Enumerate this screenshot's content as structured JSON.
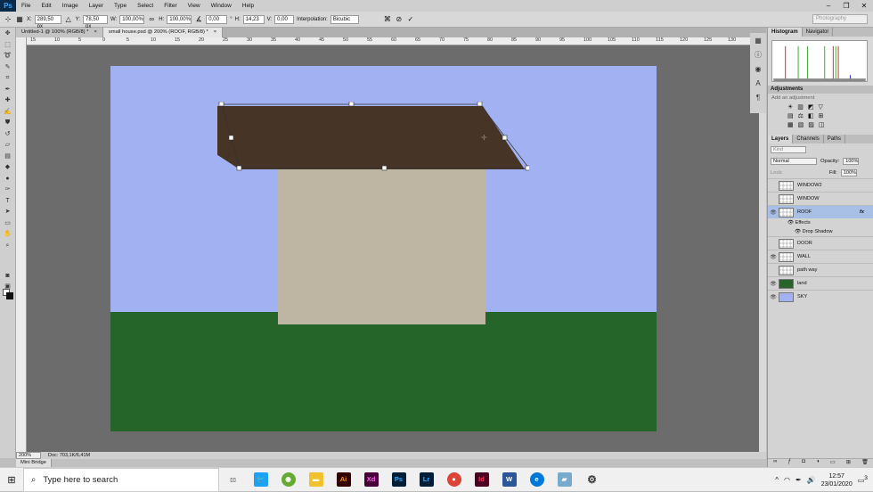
{
  "app": {
    "logo": "Ps"
  },
  "menu": [
    "File",
    "Edit",
    "Image",
    "Layer",
    "Type",
    "Select",
    "Filter",
    "View",
    "Window",
    "Help"
  ],
  "window_controls": [
    "–",
    "❐",
    "✕"
  ],
  "options": {
    "x_label": "X:",
    "x_value": "289,50 px",
    "y_label": "Y:",
    "y_value": "78,50 px",
    "w_label": "W:",
    "w_value": "100,00%",
    "h_label": "H:",
    "h_value": "100,00%",
    "angle_value": "0,00",
    "hskew_label": "H:",
    "hskew_value": "14,23",
    "vskew_label": "V:",
    "vskew_value": "0,00",
    "interp_label": "Interpolation:",
    "interp_value": "Bicubic",
    "workspace": "Photography"
  },
  "doc_tabs": [
    {
      "label": "Untitled-1 @ 100% (RGB/8) *",
      "close": "×"
    },
    {
      "label": "small house.psd @ 200% (ROOF, RGB/8) *",
      "close": "×"
    }
  ],
  "ruler_labels": [
    "15",
    "10",
    "5",
    "0",
    "5",
    "10",
    "15",
    "20",
    "25",
    "30",
    "35",
    "40",
    "45",
    "50",
    "55",
    "60",
    "65",
    "70",
    "75",
    "80",
    "85",
    "90",
    "95",
    "100",
    "105",
    "110",
    "115",
    "120",
    "125",
    "130"
  ],
  "status": {
    "zoom": "200%",
    "doc_size": "Doc: 703,1K/6,41M"
  },
  "mini_bridge": "Mini Bridge",
  "panels": {
    "top_tabs": [
      "Histogram",
      "Navigator"
    ],
    "adjustments_title": "Adjustments",
    "adjustments_hint": "Add an adjustment",
    "adj_row1": [
      "☀",
      "▥",
      "◩",
      "▽"
    ],
    "adj_row2": [
      "▤",
      "⚖",
      "◧",
      "⊞"
    ],
    "adj_row3": [
      "▦",
      "▧",
      "▨",
      "◫"
    ],
    "layer_tabs": [
      "Layers",
      "Channels",
      "Paths"
    ],
    "kind_label": "Kind",
    "blend_mode": "Normal",
    "opacity_label": "Opacity:",
    "opacity_value": "100%",
    "lock_label": "Lock:",
    "fill_label": "Fill:",
    "fill_value": "100%",
    "layers": [
      "WINDOW2",
      "WINDOW",
      "ROOF",
      "DOOR",
      "WALL",
      "path way",
      "land",
      "SKY"
    ],
    "effects_label": "Effects",
    "effect_name": "Drop Shadow",
    "fx_label": "fx"
  },
  "colors": {
    "sky": "#a1b1f1",
    "land": "#25652a",
    "wall": "#bfb5a3",
    "roof": "#463427"
  },
  "taskbar": {
    "search_placeholder": "Type here to search",
    "apps": [
      "Ai",
      "Xd",
      "Ps",
      "Lr",
      "Id",
      "W"
    ],
    "time": "12:57",
    "date": "23/01/2020",
    "notif_count": "3"
  }
}
